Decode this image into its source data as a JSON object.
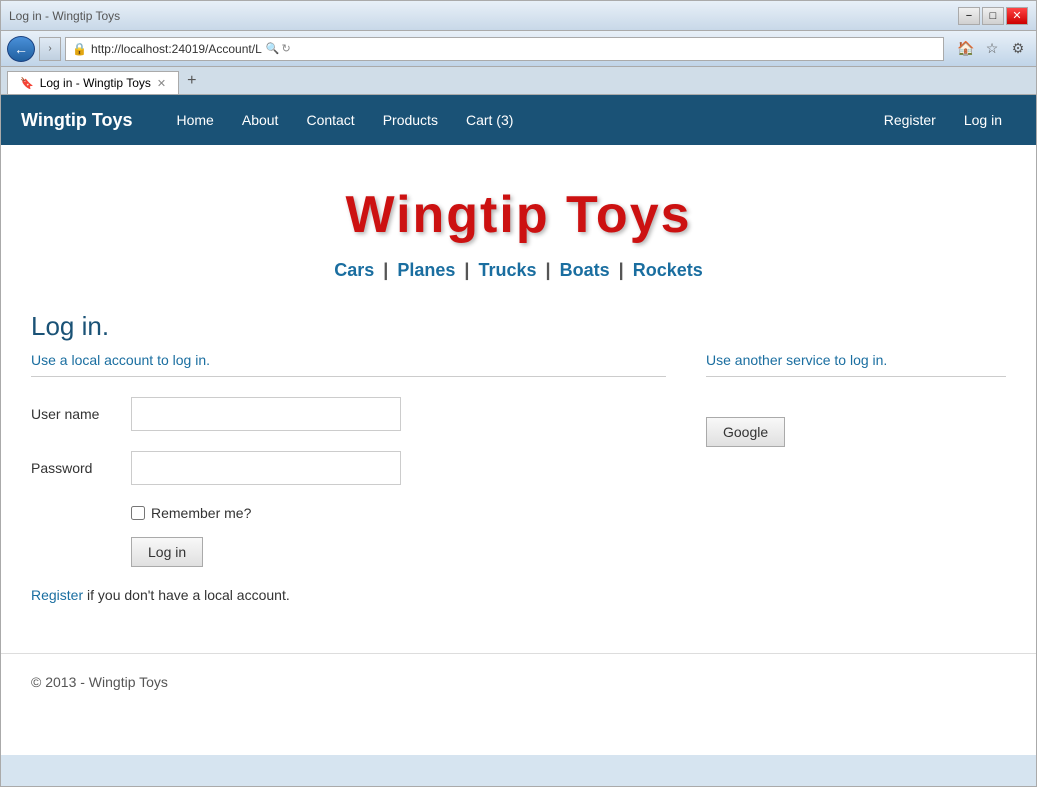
{
  "browser": {
    "title_bar": {
      "minimize": "−",
      "maximize": "□",
      "close": "✕"
    },
    "address": "http://localhost:24019/Account/L",
    "tab_title": "Log in - Wingtip Toys",
    "tab_icon": "🔖",
    "back_arrow": "←",
    "forward_arrow": "→"
  },
  "site": {
    "brand": "Wingtip Toys",
    "nav_links": [
      "Home",
      "About",
      "Contact",
      "Products",
      "Cart (3)"
    ],
    "nav_right": [
      "Register",
      "Log in"
    ]
  },
  "hero": {
    "title": "Wingtip Toys"
  },
  "categories": {
    "items": [
      "Cars",
      "Planes",
      "Trucks",
      "Boats",
      "Rockets"
    ],
    "separator": "|"
  },
  "page": {
    "heading": "Log in.",
    "local_label": "Use a local account to log in.",
    "service_label": "Use another service to log in.",
    "username_label": "User name",
    "password_label": "Password",
    "remember_label": "Remember me?",
    "login_btn": "Log in",
    "register_text": "if you don't have a local account.",
    "register_link": "Register",
    "google_btn": "Google"
  },
  "footer": {
    "text": "© 2013 - Wingtip Toys"
  }
}
